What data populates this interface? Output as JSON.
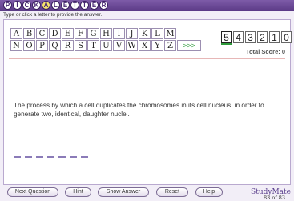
{
  "app": {
    "logo_text": "PICK-A-LETTER",
    "instruction": "Type or click a letter to provide the answer."
  },
  "letters": {
    "row1": [
      "A",
      "B",
      "C",
      "D",
      "E",
      "F",
      "G",
      "H",
      "I",
      "J",
      "K",
      "L",
      "M"
    ],
    "row2": [
      "N",
      "O",
      "P",
      "Q",
      "R",
      "S",
      "T",
      "U",
      "V",
      "W",
      "X",
      "Y",
      "Z"
    ],
    "more_label": ">>>"
  },
  "score": {
    "digits": [
      "5",
      "4",
      "3",
      "2",
      "1",
      "0"
    ],
    "total_label": "Total Score: 0"
  },
  "question": {
    "text": "The process by which a cell duplicates the chromosomes in its cell nucleus, in order to generate two, identical, daughter nuclei.",
    "blank_count": 7
  },
  "counter": "83 of 83",
  "toolbar": {
    "next_label": "Next Question",
    "hint_label": "Hint",
    "show_answer_label": "Show Answer",
    "reset_label": "Reset",
    "help_label": "Help"
  },
  "brand": "StudyMate"
}
